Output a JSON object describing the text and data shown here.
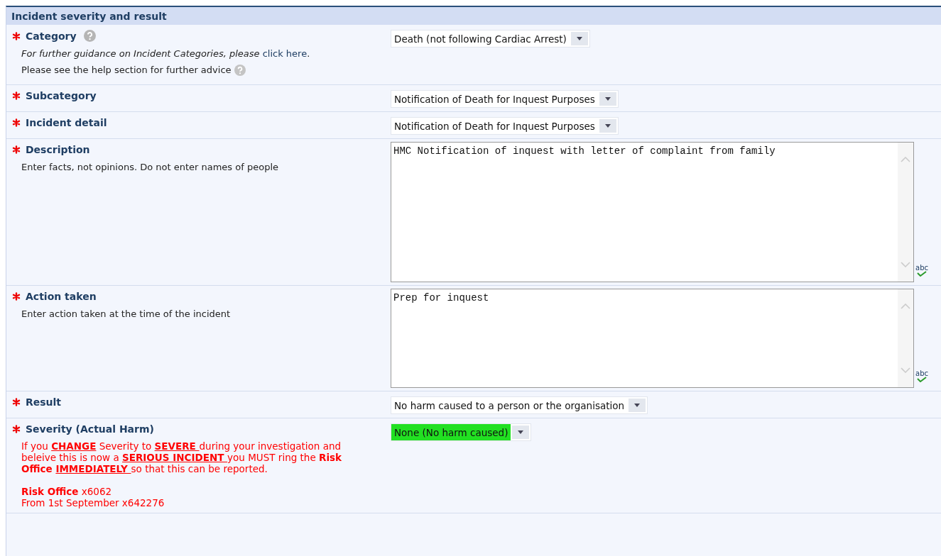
{
  "section": {
    "title": "Incident severity and result"
  },
  "fields": [
    {
      "kind": "select",
      "label": "Category",
      "required": true,
      "help": true,
      "value": "Death (not following Cardiac Arrest)",
      "notes": [
        {
          "kind": "guidance",
          "help": false,
          "segments": [
            {
              "kind": "italic",
              "text": "For further guidance on Incident Categories, please "
            },
            {
              "kind": "link",
              "text": "click here"
            },
            {
              "kind": "plain",
              "text": "."
            }
          ]
        },
        {
          "kind": "guidance",
          "help": true,
          "segments": [
            {
              "kind": "plain",
              "text": "Please see the help section for further advice"
            }
          ]
        }
      ]
    },
    {
      "kind": "select",
      "label": "Subcategory",
      "required": true,
      "help": false,
      "value": "Notification of Death for Inquest Purposes"
    },
    {
      "kind": "select",
      "label": "Incident detail",
      "required": true,
      "help": false,
      "value": "Notification of Death for Inquest Purposes"
    },
    {
      "kind": "textarea",
      "label": "Description",
      "required": true,
      "help": false,
      "value": "HMC Notification of inquest with letter of complaint from family",
      "spellcheck": "abc",
      "notes": [
        {
          "kind": "guidance",
          "help": false,
          "segments": [
            {
              "kind": "plain",
              "text": "Enter facts, not opinions. Do not enter names of people"
            }
          ]
        }
      ]
    },
    {
      "kind": "textarea",
      "label": "Action taken",
      "required": true,
      "help": false,
      "value": "Prep for inquest",
      "spellcheck": "abc",
      "notes": [
        {
          "kind": "guidance",
          "help": false,
          "segments": [
            {
              "kind": "plain",
              "text": "Enter action taken at the time of the incident"
            }
          ]
        }
      ]
    },
    {
      "kind": "select",
      "label": "Result",
      "required": true,
      "help": false,
      "value": "No harm caused to a person or the organisation"
    },
    {
      "kind": "select",
      "label": "Severity (Actual Harm)",
      "required": true,
      "help": false,
      "value": "None (No harm caused)",
      "color": "#22e022",
      "notes": [
        {
          "kind": "warning",
          "help": false,
          "segments": [
            {
              "kind": "plain",
              "text": "If you "
            },
            {
              "kind": "bold_underline",
              "text": "CHANGE"
            },
            {
              "kind": "plain",
              "text": " Severity to "
            },
            {
              "kind": "bold_underline",
              "text": "SEVERE "
            },
            {
              "kind": "plain",
              "text": "during your investigation and beleive this is now a "
            },
            {
              "kind": "bold_underline",
              "text": "SERIOUS INCIDENT "
            },
            {
              "kind": "plain",
              "text": "you MUST ring the "
            },
            {
              "kind": "bold",
              "text": "Risk Office "
            },
            {
              "kind": "bold_underline",
              "text": "IMMEDIATELY "
            },
            {
              "kind": "plain",
              "text": "so that this can be reported."
            }
          ]
        },
        {
          "kind": "warning",
          "help": false,
          "segments": [
            {
              "kind": "bold",
              "text": "Risk Office"
            },
            {
              "kind": "plain",
              "text": " x6062"
            }
          ]
        },
        {
          "kind": "warning",
          "help": false,
          "segments": [
            {
              "kind": "plain",
              "text": "From 1st September x642276"
            }
          ]
        }
      ]
    }
  ]
}
